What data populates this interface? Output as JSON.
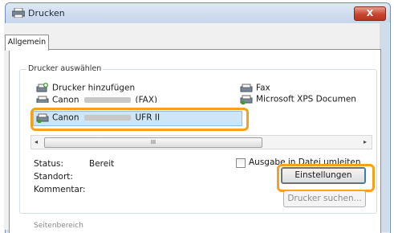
{
  "window": {
    "title": "Drucken",
    "close_label": "X"
  },
  "tabs": [
    {
      "label": "Allgemein"
    }
  ],
  "printer_group": {
    "label": "Drucker auswählen",
    "items": [
      {
        "name": "Drucker hinzufügen",
        "icon": "add-printer-icon"
      },
      {
        "name": "Canon",
        "suffix": "(FAX)",
        "icon": "printer-icon"
      },
      {
        "name": "Canon",
        "suffix": "UFR II",
        "icon": "printer-icon",
        "selected": true
      },
      {
        "name": "Fax",
        "icon": "fax-icon"
      },
      {
        "name": "Microsoft XPS Documen",
        "icon": "xps-printer-icon"
      }
    ]
  },
  "scrollbar": {
    "thumb_grip": "III"
  },
  "status": {
    "status_label": "Status:",
    "status_value": "Bereit",
    "location_label": "Standort:",
    "comment_label": "Kommentar:"
  },
  "print_to_file": {
    "label": "Ausgabe in Datei umleiten",
    "checked": false
  },
  "buttons": {
    "settings": "Einstellungen",
    "find_printer": "Drucker suchen..."
  },
  "page_range_group": {
    "label": "Seitenbereich"
  },
  "colors": {
    "highlight": "#f2a31b",
    "selection": "#cde6f7"
  }
}
